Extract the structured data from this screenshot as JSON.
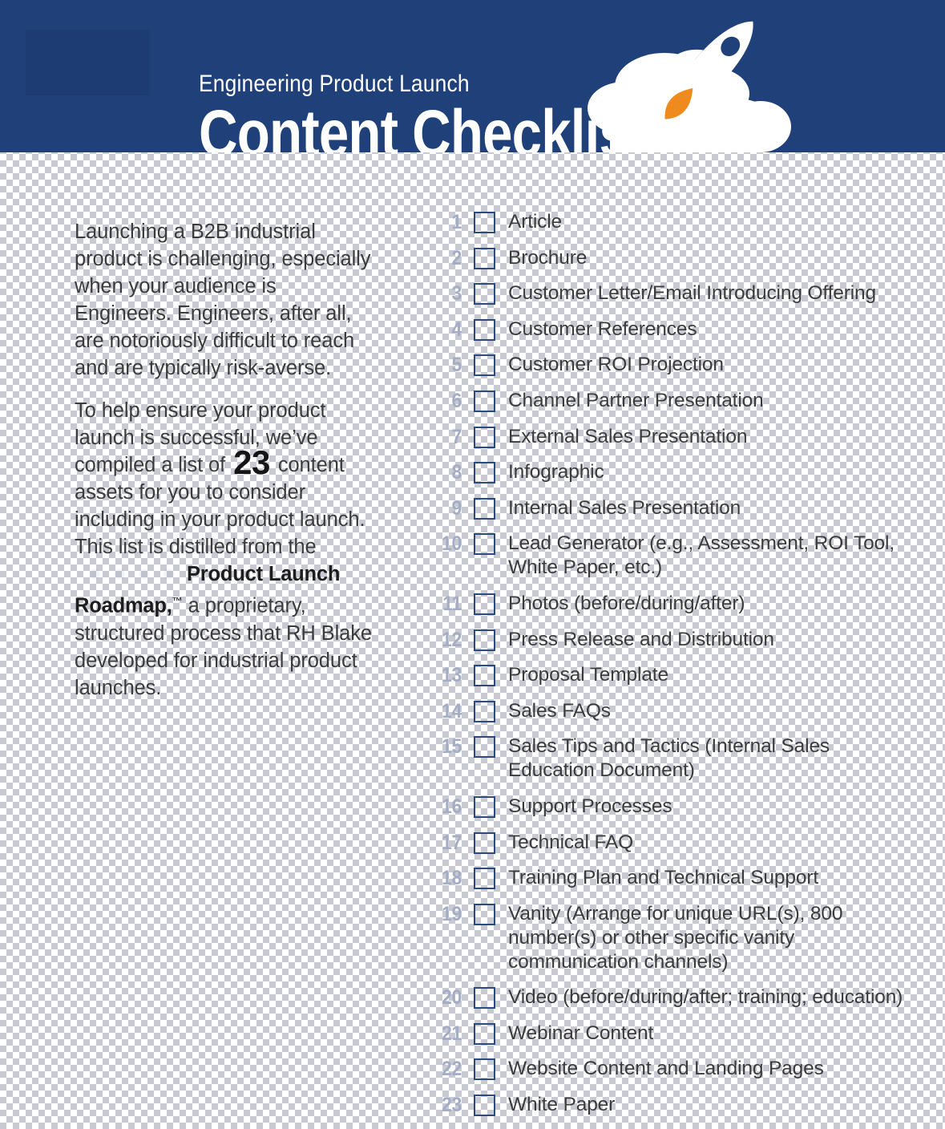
{
  "header": {
    "kicker": "Engineering Product Launch",
    "headline": "Content Checklist",
    "bg_color": "#1f4079",
    "text_color": "#ffffff",
    "rocket_body_color": "#ffffff",
    "rocket_flame_color": "#ef8b1e",
    "cloud_color": "#ffffff"
  },
  "intro": {
    "paragraph1": "Launching a B2B industrial product is challenging, especially when your audience is Engineers. Engineers, after all, are notoriously difficult to reach and are typically risk-averse.",
    "p2_before_number": "To help ensure your product launch is successful, we’ve compiled a list of ",
    "count": "23",
    "p2_after_number": " content assets for you to consider including in your product launch. This list is distilled from the ",
    "brand_name": "Product Launch Roadmap,",
    "brand_tm": "™",
    "p2_tail": " a proprietary, structured process that RH Blake developed for industrial product launches.",
    "text_color": "#3b3b3b"
  },
  "checklist": {
    "number_color": "#a3adc6",
    "checkbox_color": "#2b4a7e",
    "items": [
      {
        "num": "1",
        "label": "Article"
      },
      {
        "num": "2",
        "label": "Brochure"
      },
      {
        "num": "3",
        "label": "Customer Letter/Email Introducing Offering"
      },
      {
        "num": "4",
        "label": "Customer References"
      },
      {
        "num": "5",
        "label": "Customer ROI Projection"
      },
      {
        "num": "6",
        "label": "Channel Partner Presentation"
      },
      {
        "num": "7",
        "label": "External Sales Presentation"
      },
      {
        "num": "8",
        "label": "Infographic"
      },
      {
        "num": "9",
        "label": "Internal Sales Presentation"
      },
      {
        "num": "10",
        "label": "Lead Generator (e.g., Assessment, ROI Tool, White Paper, etc.)"
      },
      {
        "num": "11",
        "label": "Photos (before/during/after)"
      },
      {
        "num": "12",
        "label": "Press Release and Distribution"
      },
      {
        "num": "13",
        "label": "Proposal Template"
      },
      {
        "num": "14",
        "label": "Sales FAQs"
      },
      {
        "num": "15",
        "label": "Sales Tips and Tactics (Internal Sales Education Document)"
      },
      {
        "num": "16",
        "label": "Support Processes"
      },
      {
        "num": "17",
        "label": "Technical FAQ"
      },
      {
        "num": "18",
        "label": "Training Plan and Technical Support"
      },
      {
        "num": "19",
        "label": "Vanity (Arrange for unique URL(s), 800 number(s) or other specific vanity communication channels)"
      },
      {
        "num": "20",
        "label": "Video (before/during/after; training; education)"
      },
      {
        "num": "21",
        "label": "Webinar Content"
      },
      {
        "num": "22",
        "label": "Website Content and Landing Pages"
      },
      {
        "num": "23",
        "label": "White Paper"
      }
    ]
  }
}
